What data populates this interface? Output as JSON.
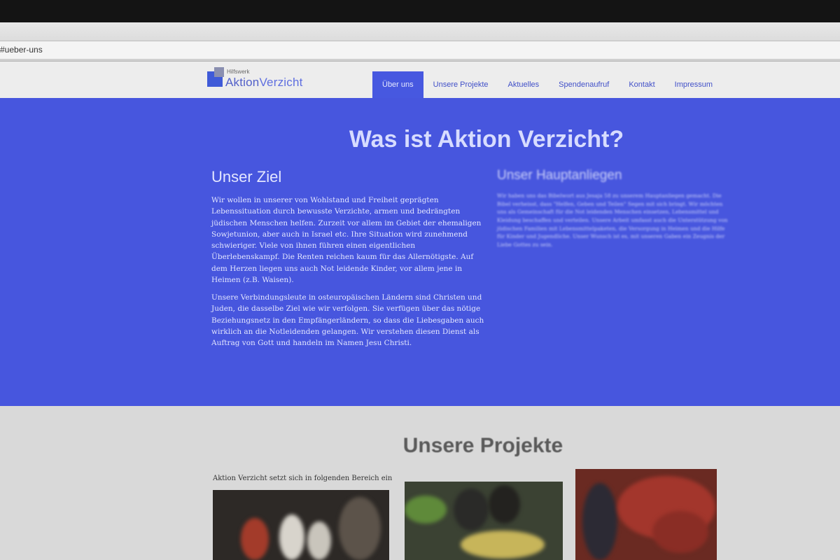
{
  "browser": {
    "url": "#ueber-uns"
  },
  "header": {
    "logo_small": "Hilfswerk",
    "logo_part1": "Aktion",
    "logo_part2": "Verzicht",
    "nav": [
      {
        "label": "Über uns",
        "active": true
      },
      {
        "label": "Unsere Projekte",
        "active": false
      },
      {
        "label": "Aktuelles",
        "active": false
      },
      {
        "label": "Spendenaufruf",
        "active": false
      },
      {
        "label": "Kontakt",
        "active": false
      },
      {
        "label": "Impressum",
        "active": false
      }
    ]
  },
  "hero": {
    "title": "Was ist Aktion Verzicht?",
    "left": {
      "heading": "Unser Ziel",
      "paragraph1": "Wir wollen in unserer von Wohlstand und Freiheit geprägten Lebenssituation durch bewusste Verzichte, armen und bedrängten jüdischen Menschen helfen. Zurzeit vor allem im Gebiet der ehemaligen Sowjetunion, aber auch in Israel etc. Ihre Situation wird zunehmend schwieriger. Viele von ihnen führen einen eigentlichen Überlebenskampf. Die Renten reichen kaum für das Allernötigste. Auf dem Herzen liegen uns auch Not leidende Kinder, vor allem jene in Heimen (z.B. Waisen).",
      "paragraph2": "Unsere Verbindungsleute in osteuropäischen Ländern sind Christen und Juden, die dasselbe Ziel wie wir verfolgen. Sie verfügen über das nötige Beziehungsnetz in den Empfängerländern, so dass die Liebesgaben auch wirklich an die Notleidenden gelangen. Wir verstehen diesen Dienst als Auftrag von Gott und handeln im Namen Jesu Christi."
    },
    "right": {
      "heading": "Unser Hauptanliegen",
      "paragraph1": "Wir haben uns das Bibelwort aus Jesaja 58 zu unserem Hauptanliegen gemacht. Die Bibel verheisst, dass \"Helfen, Geben und Teilen\" Segen mit sich bringt. Wir möchten uns als Gemeinschaft für die Not leidenden Menschen einsetzen, Lebensmittel und Kleidung beschaffen und verteilen. Unsere Arbeit umfasst auch die Unterstützung von jüdischen Familien mit Lebensmittelpaketen, die Versorgung in Heimen und die Hilfe für Kinder und Jugendliche. Unser Wunsch ist es, mit unseren Gaben ein Zeugnis der Liebe Gottes zu sein."
    }
  },
  "projects": {
    "title": "Unsere Projekte",
    "intro": "Aktion Verzicht setzt sich in folgenden Bereich ein"
  }
}
